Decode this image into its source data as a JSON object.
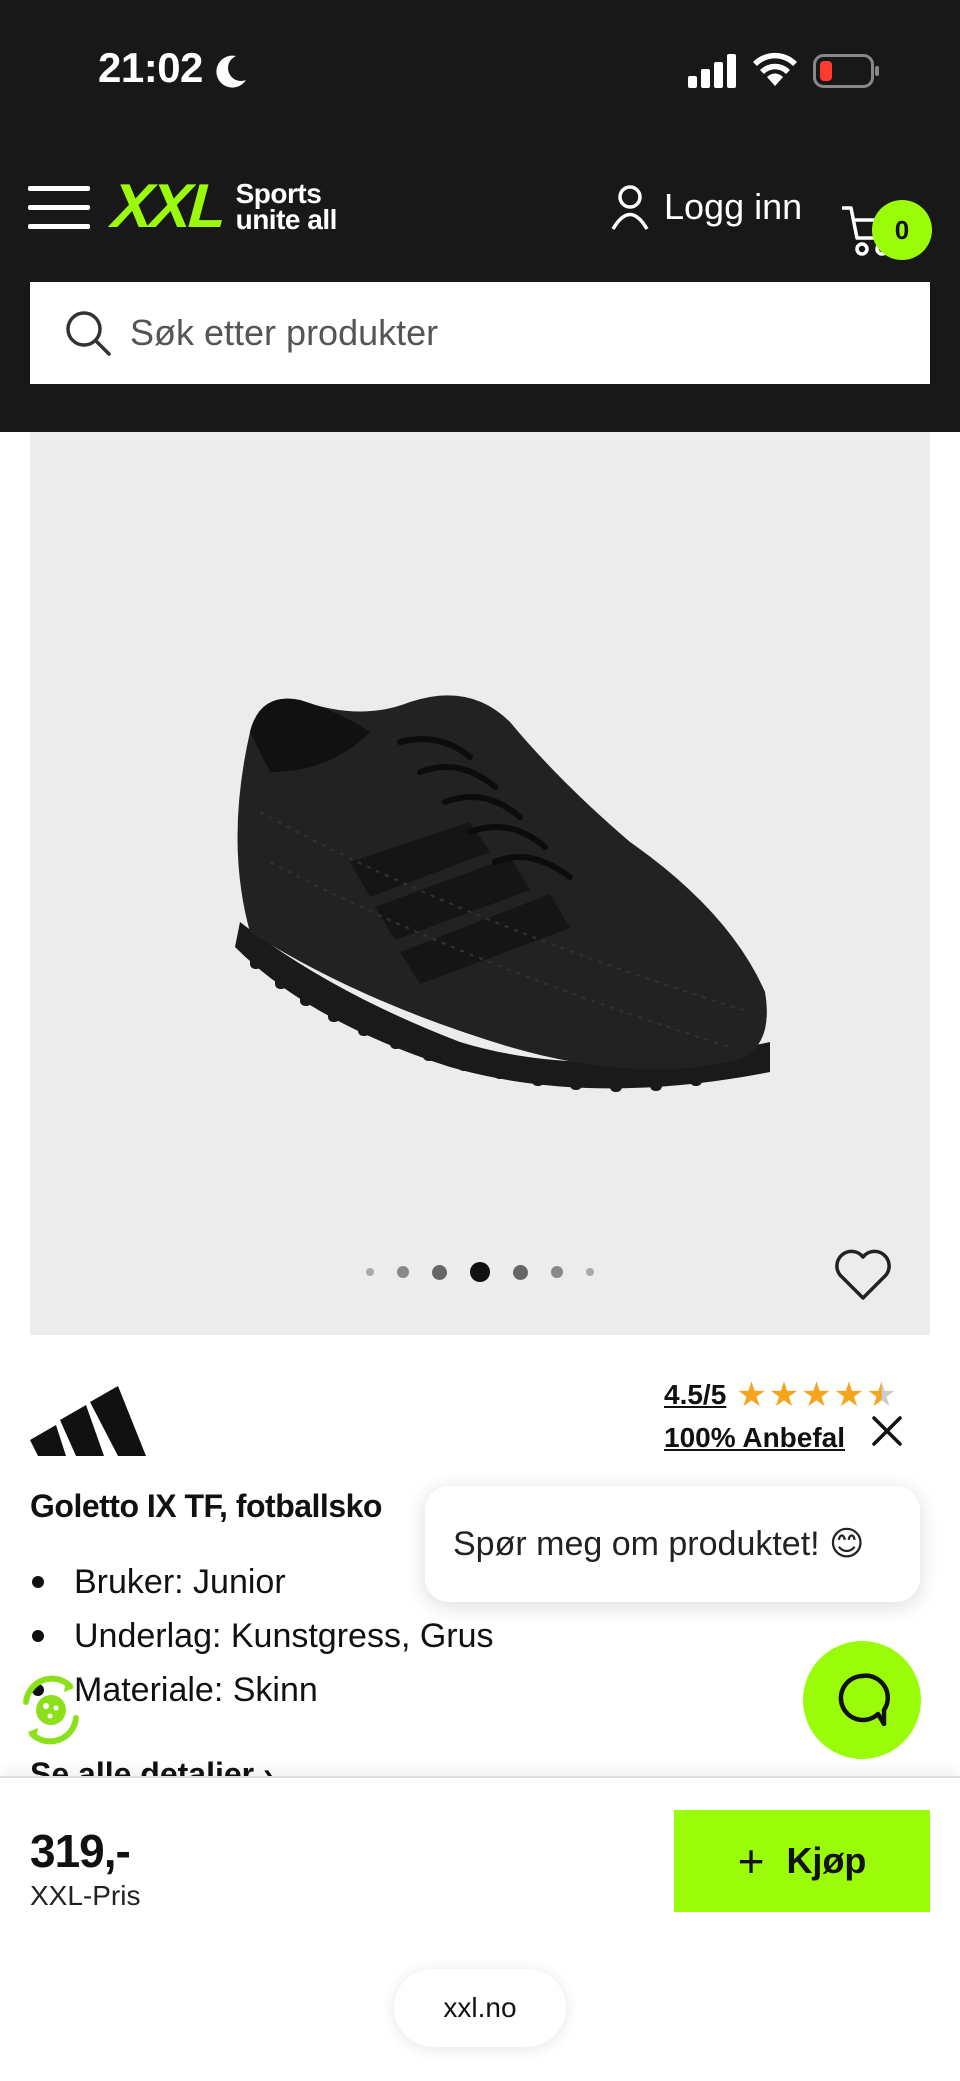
{
  "status_bar": {
    "time": "21:02"
  },
  "header": {
    "logo_main": "XXL",
    "logo_tagline_line1": "Sports",
    "logo_tagline_line2": "unite all",
    "login_label": "Logg inn",
    "cart_count": "0",
    "accent_color": "#9bfc0a"
  },
  "search": {
    "placeholder": "Søk etter produkter"
  },
  "gallery": {
    "image_alt": "Black football shoe",
    "slide_count": 7,
    "active_slide": 4
  },
  "product": {
    "brand": "adidas",
    "rating": "4.5/5",
    "stars": 4.5,
    "recommend": "100% Anbefal",
    "title": "Goletto IX TF, fotballsko",
    "specs": [
      "Bruker: Junior",
      "Underlag: Kunstgress, Grus",
      "Materiale: Skinn"
    ],
    "details_link": "Se alle detaljer"
  },
  "chat": {
    "bubble_text": "Spør meg om produktet! 😊"
  },
  "buy": {
    "price": "319,-",
    "price_label": "XXL-Pris",
    "button_label": "Kjøp"
  },
  "browser": {
    "url": "xxl.no"
  }
}
